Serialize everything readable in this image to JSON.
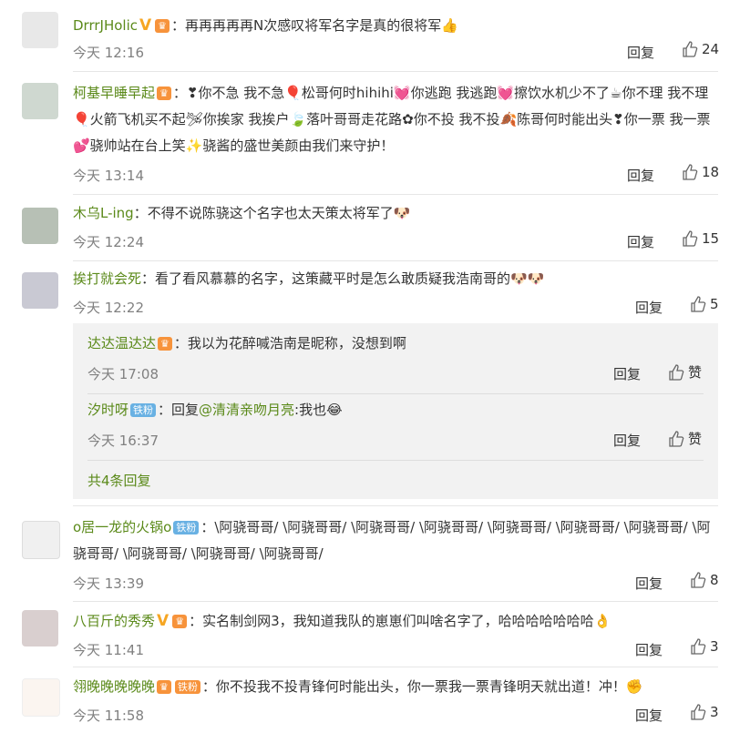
{
  "comments": [
    {
      "user": "DrrrJHolic",
      "text": "：再再再再再N次感叹将军名字是真的很将军👍",
      "time": "今天 12:16",
      "reply": "回复",
      "likes": "24"
    },
    {
      "user": "柯基早睡早起",
      "text": "：❣你不急 我不急🎈松哥何时hihihi💓你逃跑 我逃跑💓擦饮水机少不了☕你不理 我不理🎈火箭飞机买不起🛩你挨家 我挨户🍃落叶哥哥走花路✿你不投 我不投🍂陈哥何时能出头❣你一票 我一票💕骁帅站在台上笑✨骁酱的盛世美颜由我们来守护！",
      "time": "今天 13:14",
      "reply": "回复",
      "likes": "18"
    },
    {
      "user": "木乌L-ing",
      "text": "：不得不说陈骁这个名字也太天策太将军了🐶",
      "time": "今天 12:24",
      "reply": "回复",
      "likes": "15"
    },
    {
      "user": "挨打就会死",
      "text": "：看了看风慕慕的名字，这策藏平时是怎么敢质疑我浩南哥的🐶🐶",
      "time": "今天 12:22",
      "reply": "回复",
      "likes": "5"
    },
    {
      "user": "o居一龙的火锅o",
      "text": "：\\阿骁哥哥/ \\阿骁哥哥/ \\阿骁哥哥/ \\阿骁哥哥/ \\阿骁哥哥/ \\阿骁哥哥/ \\阿骁哥哥/ \\阿骁哥哥/ \\阿骁哥哥/ \\阿骁哥哥/ \\阿骁哥哥/",
      "time": "今天 13:39",
      "reply": "回复",
      "likes": "8",
      "fan": "铁粉"
    },
    {
      "user": "八百斤的秀秀",
      "text": "：实名制剑网3，我知道我队的崽崽们叫啥名字了，哈哈哈哈哈哈哈👌",
      "time": "今天 11:41",
      "reply": "回复",
      "likes": "3"
    },
    {
      "user": "翎晚晚晚晚晚",
      "text": "：你不投我不投青锋何时能出头，你一票我一票青锋明天就出道！冲！✊",
      "time": "今天 11:58",
      "reply": "回复",
      "likes": "3",
      "fan": "铁粉"
    }
  ],
  "subreplies": [
    {
      "user": "达达温达达",
      "text": "：我以为花醉喊浩南是昵称，没想到啊",
      "time": "今天 17:08",
      "reply": "回复",
      "likes": "赞"
    },
    {
      "user": "汐时呀",
      "fan": "铁粉",
      "pre": "：回复",
      "mention": "@清清亲吻月亮",
      "text": ":我也😂",
      "time": "今天 16:37",
      "reply": "回复",
      "likes": "赞"
    }
  ],
  "more_replies": "共4条回复",
  "colors": {
    "username": "#5b8a1a",
    "time": "#808080",
    "subbox": "#f2f2f2",
    "level_badge": "#f7933b",
    "fan_badge": "#69b1e3"
  }
}
